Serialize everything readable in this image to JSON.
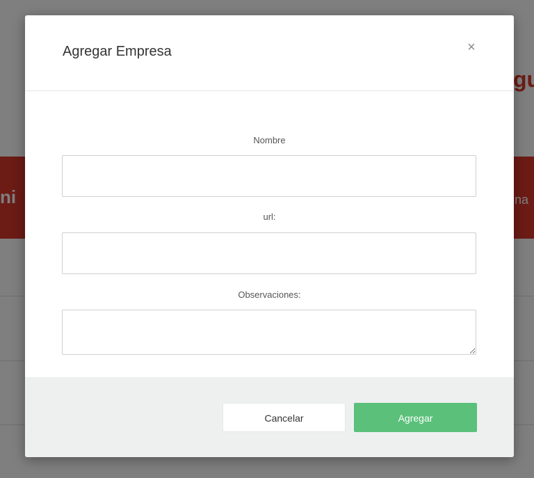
{
  "background": {
    "heading_fragment": "gu",
    "banner_left_fragment": "ni",
    "banner_right_fragment": "na",
    "banner_color": "#d8372a"
  },
  "modal": {
    "title": "Agregar Empresa",
    "close_icon": "×",
    "fields": [
      {
        "label": "Nombre",
        "value": "",
        "placeholder": ""
      },
      {
        "label": "url:",
        "value": "",
        "placeholder": ""
      },
      {
        "label": "Observaciones:",
        "value": "",
        "placeholder": ""
      }
    ],
    "buttons": {
      "cancel_label": "Cancelar",
      "add_label": "Agregar"
    },
    "colors": {
      "add_button": "#5bc07a",
      "footer_bg": "#eef0f0"
    }
  }
}
